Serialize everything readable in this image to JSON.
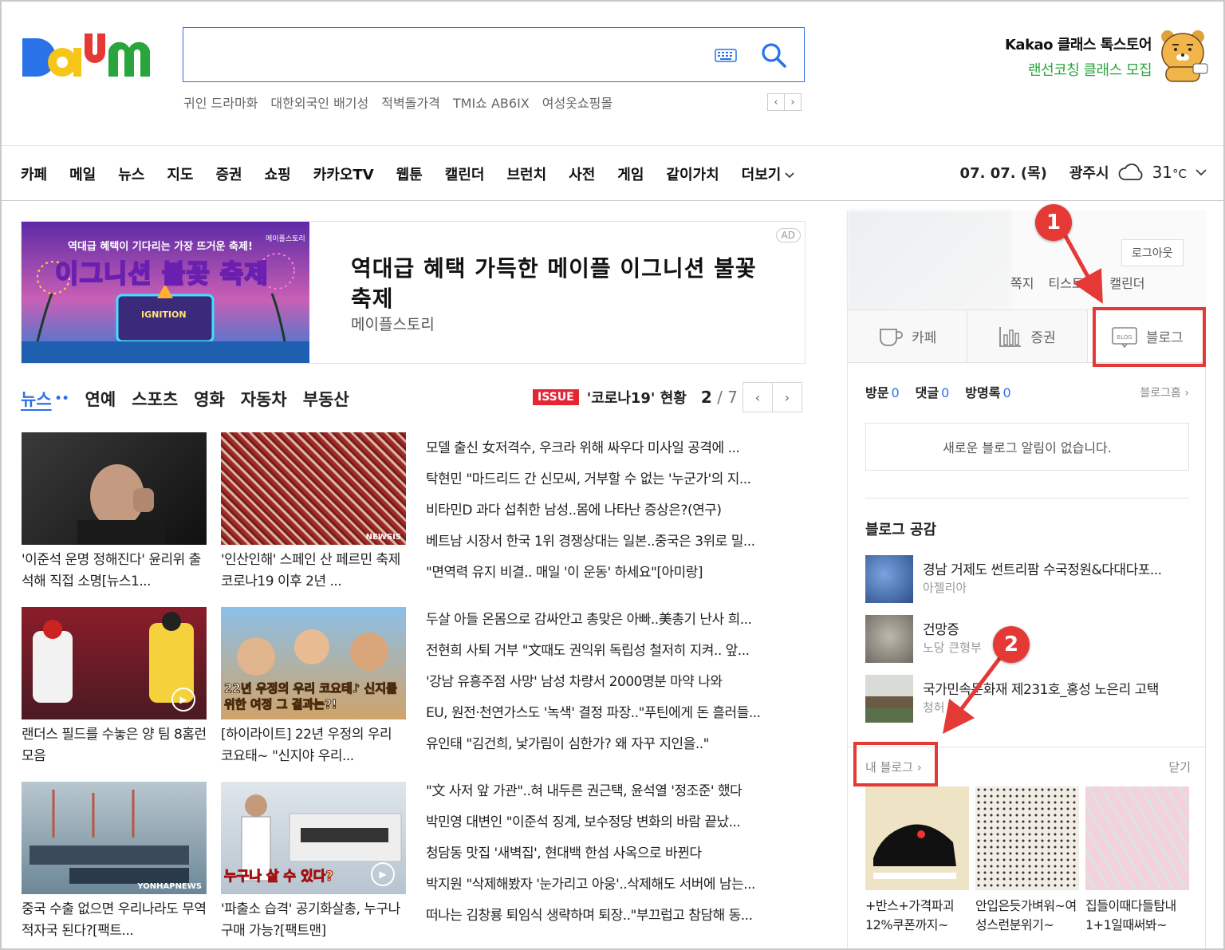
{
  "header": {
    "logo_text": "Daum",
    "search_placeholder": "",
    "trending": [
      "귀인 드라마화",
      "대한외국인 배기성",
      "적벽돌가격",
      "TMI쇼 AB6IX",
      "여성옷쇼핑몰"
    ],
    "trend_prev": "‹",
    "trend_next": "›",
    "promo_line1": "Kakao 클래스 톡스토어",
    "promo_line2": "랜선코칭 클래스 모집"
  },
  "gnb": {
    "items": [
      "카페",
      "메일",
      "뉴스",
      "지도",
      "증권",
      "쇼핑",
      "카카오TV",
      "웹툰",
      "캘린더",
      "브런치",
      "사전",
      "게임",
      "같이가치",
      "더보기"
    ],
    "more_icon": "chevron-down-icon",
    "date": "07. 07. (목)",
    "city": "광주시",
    "weather_icon": "cloud-icon",
    "temperature": "31",
    "temp_unit": "°C"
  },
  "ad": {
    "image_text_small": "역대급 혜택이 기다리는 가장 뜨거운 축제!",
    "image_text_big": "이그니션 불꽃 축제",
    "image_logo": "메이플스토리",
    "image_center": "IGNITION",
    "title": "역대급 혜택 가득한 메이플 이그니션 불꽃 축제",
    "brand": "메이플스토리",
    "badge": "AD"
  },
  "news": {
    "tabs": [
      "뉴스",
      "연예",
      "스포츠",
      "영화",
      "자동차",
      "부동산"
    ],
    "active_tab": "뉴스",
    "issue_badge": "ISSUE",
    "issue_text": "'코로나19' 현황",
    "page_current": "2",
    "page_total": "/ 7",
    "thumbs": [
      {
        "caption": "'이준석 운명 정해진다' 윤리위 출석해 직접 소명[뉴스1...",
        "video": false
      },
      {
        "caption": "'인산인해' 스페인 산 페르민 축제 코로나19 이후 2년 ...",
        "video": false,
        "mark": "NEWSIS"
      },
      {
        "caption": "랜더스 필드를 수놓은 양 팀 8홈런 모음",
        "video": true
      },
      {
        "caption": "[하이라이트] 22년 우정의 우리 코요태~ \"신지야 우리...",
        "video": false,
        "img_text": "22년 우정의 우리 코요태♪ 신지를 위한 여정 그 결과는?!"
      },
      {
        "caption": "중국 수출 없으면 우리나라도 무역적자국 된다?[팩트...",
        "video": false,
        "mark": "YONHAPNEWS"
      },
      {
        "caption": "'파출소 습격' 공기화살총, 누구나 구매 가능?[팩트맨]",
        "video": true,
        "img_text": "누구나 살 수 있다?"
      }
    ],
    "headlines_1": [
      "모델 출신 女저격수, 우크라 위해 싸우다 미사일 공격에 ...",
      "탁현민 \"마드리드 간 신모씨, 거부할 수 없는 '누군가'의 지...",
      "비타민D 과다 섭취한 남성..몸에 나타난 증상은?(연구)",
      "베트남 시장서 한국 1위 경쟁상대는 일본..중국은 3위로 밀...",
      "\"면역력 유지 비결.. 매일 '이 운동' 하세요\"[아미랑]"
    ],
    "headlines_2": [
      "두살 아들 온몸으로 감싸안고 총맞은 아빠..美총기 난사 희...",
      "전현희 사퇴 거부 \"文때도 권익위 독립성 철저히 지켜.. 앞...",
      "'강남 유흥주점 사망' 남성 차량서 2000명분 마약 나와",
      "EU, 원전·천연가스도 '녹색' 결정 파장..\"푸틴에게 돈 흘러들...",
      "유인태 \"김건희, 낯가림이 심한가? 왜 자꾸 지인을..\""
    ],
    "headlines_3": [
      "\"文 사저 앞 가관\"..혀 내두른 권근택, 윤석열 '정조준' 했다",
      "박민영 대변인 \"이준석 징계, 보수정당 변화의 바람 끝났...",
      "청담동 맛집 '새벽집', 현대백 한섬 사옥으로 바뀐다",
      "박지원 \"삭제해봤자 '눈가리고 아웅'..삭제해도 서버에 남는...",
      "떠나는 김창룡 퇴임식 생략하며 퇴장..\"부끄럽고 참담해 동..."
    ],
    "prev": "‹",
    "next": "›"
  },
  "panel": {
    "logout": "로그아웃",
    "mini_links": [
      "쪽지",
      "티스토리",
      "캘린더"
    ],
    "tabs": [
      {
        "label": "카페",
        "icon": "cafe-cup-icon"
      },
      {
        "label": "증권",
        "icon": "stock-chart-icon"
      },
      {
        "label": "블로그",
        "icon": "blog-icon"
      }
    ],
    "blog_icon_text": "BLOG",
    "stats": [
      {
        "label": "방문",
        "value": "0"
      },
      {
        "label": "댓글",
        "value": "0"
      },
      {
        "label": "방명록",
        "value": "0"
      }
    ],
    "blog_home": "블로그홈 ›",
    "notice": "새로운 블로그 알림이 없습니다.",
    "gonggam_title": "블로그 공감",
    "gonggam": [
      {
        "title": "경남 거제도 썬트리팜 수국정원&다대다포...",
        "author": "아젤리아"
      },
      {
        "title": "건망증",
        "author": "노당 큰형부"
      },
      {
        "title": "국가민속문화재 제231호_홍성 노은리 고택",
        "author": "청허"
      }
    ],
    "my_blog": "내 블로그 ›",
    "close": "닫기",
    "products": [
      "+반스+가격파괴12%쿠폰까지~",
      "안입은듯가벼워~여성스런분위기~",
      "집들이때다들탐내1+1일때써봐~"
    ]
  },
  "annotations": {
    "marker1": "1",
    "marker2": "2",
    "color": "#e53935"
  }
}
